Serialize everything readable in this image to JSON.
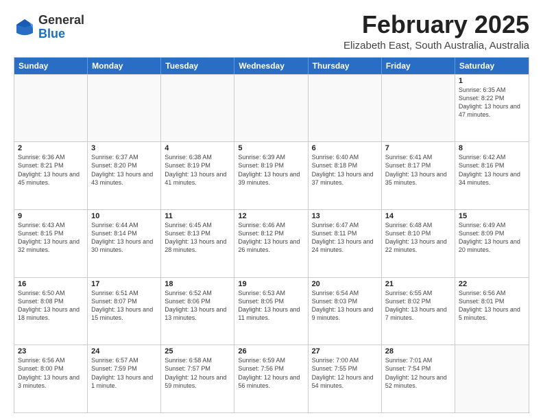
{
  "logo": {
    "general": "General",
    "blue": "Blue"
  },
  "title": "February 2025",
  "subtitle": "Elizabeth East, South Australia, Australia",
  "header_days": [
    "Sunday",
    "Monday",
    "Tuesday",
    "Wednesday",
    "Thursday",
    "Friday",
    "Saturday"
  ],
  "weeks": [
    [
      {
        "day": "",
        "empty": true
      },
      {
        "day": "",
        "empty": true
      },
      {
        "day": "",
        "empty": true
      },
      {
        "day": "",
        "empty": true
      },
      {
        "day": "",
        "empty": true
      },
      {
        "day": "",
        "empty": true
      },
      {
        "day": "1",
        "sunrise": "6:35 AM",
        "sunset": "8:22 PM",
        "daylight": "13 hours and 47 minutes."
      }
    ],
    [
      {
        "day": "2",
        "sunrise": "6:36 AM",
        "sunset": "8:21 PM",
        "daylight": "13 hours and 45 minutes."
      },
      {
        "day": "3",
        "sunrise": "6:37 AM",
        "sunset": "8:20 PM",
        "daylight": "13 hours and 43 minutes."
      },
      {
        "day": "4",
        "sunrise": "6:38 AM",
        "sunset": "8:19 PM",
        "daylight": "13 hours and 41 minutes."
      },
      {
        "day": "5",
        "sunrise": "6:39 AM",
        "sunset": "8:19 PM",
        "daylight": "13 hours and 39 minutes."
      },
      {
        "day": "6",
        "sunrise": "6:40 AM",
        "sunset": "8:18 PM",
        "daylight": "13 hours and 37 minutes."
      },
      {
        "day": "7",
        "sunrise": "6:41 AM",
        "sunset": "8:17 PM",
        "daylight": "13 hours and 35 minutes."
      },
      {
        "day": "8",
        "sunrise": "6:42 AM",
        "sunset": "8:16 PM",
        "daylight": "13 hours and 34 minutes."
      }
    ],
    [
      {
        "day": "9",
        "sunrise": "6:43 AM",
        "sunset": "8:15 PM",
        "daylight": "13 hours and 32 minutes."
      },
      {
        "day": "10",
        "sunrise": "6:44 AM",
        "sunset": "8:14 PM",
        "daylight": "13 hours and 30 minutes."
      },
      {
        "day": "11",
        "sunrise": "6:45 AM",
        "sunset": "8:13 PM",
        "daylight": "13 hours and 28 minutes."
      },
      {
        "day": "12",
        "sunrise": "6:46 AM",
        "sunset": "8:12 PM",
        "daylight": "13 hours and 26 minutes."
      },
      {
        "day": "13",
        "sunrise": "6:47 AM",
        "sunset": "8:11 PM",
        "daylight": "13 hours and 24 minutes."
      },
      {
        "day": "14",
        "sunrise": "6:48 AM",
        "sunset": "8:10 PM",
        "daylight": "13 hours and 22 minutes."
      },
      {
        "day": "15",
        "sunrise": "6:49 AM",
        "sunset": "8:09 PM",
        "daylight": "13 hours and 20 minutes."
      }
    ],
    [
      {
        "day": "16",
        "sunrise": "6:50 AM",
        "sunset": "8:08 PM",
        "daylight": "13 hours and 18 minutes."
      },
      {
        "day": "17",
        "sunrise": "6:51 AM",
        "sunset": "8:07 PM",
        "daylight": "13 hours and 15 minutes."
      },
      {
        "day": "18",
        "sunrise": "6:52 AM",
        "sunset": "8:06 PM",
        "daylight": "13 hours and 13 minutes."
      },
      {
        "day": "19",
        "sunrise": "6:53 AM",
        "sunset": "8:05 PM",
        "daylight": "13 hours and 11 minutes."
      },
      {
        "day": "20",
        "sunrise": "6:54 AM",
        "sunset": "8:03 PM",
        "daylight": "13 hours and 9 minutes."
      },
      {
        "day": "21",
        "sunrise": "6:55 AM",
        "sunset": "8:02 PM",
        "daylight": "13 hours and 7 minutes."
      },
      {
        "day": "22",
        "sunrise": "6:56 AM",
        "sunset": "8:01 PM",
        "daylight": "13 hours and 5 minutes."
      }
    ],
    [
      {
        "day": "23",
        "sunrise": "6:56 AM",
        "sunset": "8:00 PM",
        "daylight": "13 hours and 3 minutes."
      },
      {
        "day": "24",
        "sunrise": "6:57 AM",
        "sunset": "7:59 PM",
        "daylight": "13 hours and 1 minute."
      },
      {
        "day": "25",
        "sunrise": "6:58 AM",
        "sunset": "7:57 PM",
        "daylight": "12 hours and 59 minutes."
      },
      {
        "day": "26",
        "sunrise": "6:59 AM",
        "sunset": "7:56 PM",
        "daylight": "12 hours and 56 minutes."
      },
      {
        "day": "27",
        "sunrise": "7:00 AM",
        "sunset": "7:55 PM",
        "daylight": "12 hours and 54 minutes."
      },
      {
        "day": "28",
        "sunrise": "7:01 AM",
        "sunset": "7:54 PM",
        "daylight": "12 hours and 52 minutes."
      },
      {
        "day": "",
        "empty": true
      }
    ]
  ]
}
